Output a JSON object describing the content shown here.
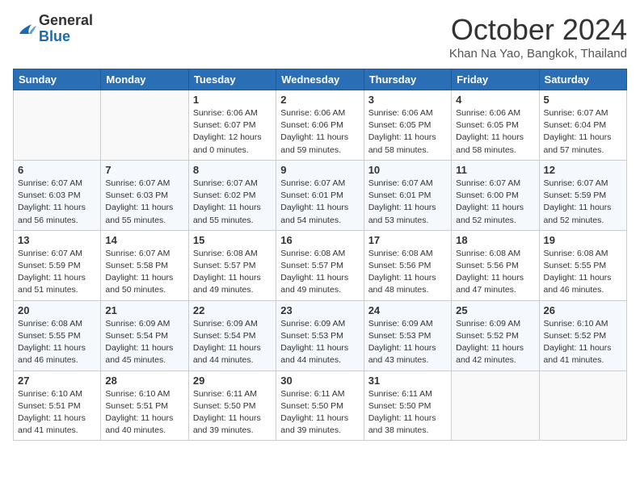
{
  "header": {
    "logo": {
      "line1": "General",
      "line2": "Blue"
    },
    "title": "October 2024",
    "location": "Khan Na Yao, Bangkok, Thailand"
  },
  "days_of_week": [
    "Sunday",
    "Monday",
    "Tuesday",
    "Wednesday",
    "Thursday",
    "Friday",
    "Saturday"
  ],
  "weeks": [
    [
      {
        "day": "",
        "info": ""
      },
      {
        "day": "",
        "info": ""
      },
      {
        "day": "1",
        "info": "Sunrise: 6:06 AM\nSunset: 6:07 PM\nDaylight: 12 hours\nand 0 minutes."
      },
      {
        "day": "2",
        "info": "Sunrise: 6:06 AM\nSunset: 6:06 PM\nDaylight: 11 hours\nand 59 minutes."
      },
      {
        "day": "3",
        "info": "Sunrise: 6:06 AM\nSunset: 6:05 PM\nDaylight: 11 hours\nand 58 minutes."
      },
      {
        "day": "4",
        "info": "Sunrise: 6:06 AM\nSunset: 6:05 PM\nDaylight: 11 hours\nand 58 minutes."
      },
      {
        "day": "5",
        "info": "Sunrise: 6:07 AM\nSunset: 6:04 PM\nDaylight: 11 hours\nand 57 minutes."
      }
    ],
    [
      {
        "day": "6",
        "info": "Sunrise: 6:07 AM\nSunset: 6:03 PM\nDaylight: 11 hours\nand 56 minutes."
      },
      {
        "day": "7",
        "info": "Sunrise: 6:07 AM\nSunset: 6:03 PM\nDaylight: 11 hours\nand 55 minutes."
      },
      {
        "day": "8",
        "info": "Sunrise: 6:07 AM\nSunset: 6:02 PM\nDaylight: 11 hours\nand 55 minutes."
      },
      {
        "day": "9",
        "info": "Sunrise: 6:07 AM\nSunset: 6:01 PM\nDaylight: 11 hours\nand 54 minutes."
      },
      {
        "day": "10",
        "info": "Sunrise: 6:07 AM\nSunset: 6:01 PM\nDaylight: 11 hours\nand 53 minutes."
      },
      {
        "day": "11",
        "info": "Sunrise: 6:07 AM\nSunset: 6:00 PM\nDaylight: 11 hours\nand 52 minutes."
      },
      {
        "day": "12",
        "info": "Sunrise: 6:07 AM\nSunset: 5:59 PM\nDaylight: 11 hours\nand 52 minutes."
      }
    ],
    [
      {
        "day": "13",
        "info": "Sunrise: 6:07 AM\nSunset: 5:59 PM\nDaylight: 11 hours\nand 51 minutes."
      },
      {
        "day": "14",
        "info": "Sunrise: 6:07 AM\nSunset: 5:58 PM\nDaylight: 11 hours\nand 50 minutes."
      },
      {
        "day": "15",
        "info": "Sunrise: 6:08 AM\nSunset: 5:57 PM\nDaylight: 11 hours\nand 49 minutes."
      },
      {
        "day": "16",
        "info": "Sunrise: 6:08 AM\nSunset: 5:57 PM\nDaylight: 11 hours\nand 49 minutes."
      },
      {
        "day": "17",
        "info": "Sunrise: 6:08 AM\nSunset: 5:56 PM\nDaylight: 11 hours\nand 48 minutes."
      },
      {
        "day": "18",
        "info": "Sunrise: 6:08 AM\nSunset: 5:56 PM\nDaylight: 11 hours\nand 47 minutes."
      },
      {
        "day": "19",
        "info": "Sunrise: 6:08 AM\nSunset: 5:55 PM\nDaylight: 11 hours\nand 46 minutes."
      }
    ],
    [
      {
        "day": "20",
        "info": "Sunrise: 6:08 AM\nSunset: 5:55 PM\nDaylight: 11 hours\nand 46 minutes."
      },
      {
        "day": "21",
        "info": "Sunrise: 6:09 AM\nSunset: 5:54 PM\nDaylight: 11 hours\nand 45 minutes."
      },
      {
        "day": "22",
        "info": "Sunrise: 6:09 AM\nSunset: 5:54 PM\nDaylight: 11 hours\nand 44 minutes."
      },
      {
        "day": "23",
        "info": "Sunrise: 6:09 AM\nSunset: 5:53 PM\nDaylight: 11 hours\nand 44 minutes."
      },
      {
        "day": "24",
        "info": "Sunrise: 6:09 AM\nSunset: 5:53 PM\nDaylight: 11 hours\nand 43 minutes."
      },
      {
        "day": "25",
        "info": "Sunrise: 6:09 AM\nSunset: 5:52 PM\nDaylight: 11 hours\nand 42 minutes."
      },
      {
        "day": "26",
        "info": "Sunrise: 6:10 AM\nSunset: 5:52 PM\nDaylight: 11 hours\nand 41 minutes."
      }
    ],
    [
      {
        "day": "27",
        "info": "Sunrise: 6:10 AM\nSunset: 5:51 PM\nDaylight: 11 hours\nand 41 minutes."
      },
      {
        "day": "28",
        "info": "Sunrise: 6:10 AM\nSunset: 5:51 PM\nDaylight: 11 hours\nand 40 minutes."
      },
      {
        "day": "29",
        "info": "Sunrise: 6:11 AM\nSunset: 5:50 PM\nDaylight: 11 hours\nand 39 minutes."
      },
      {
        "day": "30",
        "info": "Sunrise: 6:11 AM\nSunset: 5:50 PM\nDaylight: 11 hours\nand 39 minutes."
      },
      {
        "day": "31",
        "info": "Sunrise: 6:11 AM\nSunset: 5:50 PM\nDaylight: 11 hours\nand 38 minutes."
      },
      {
        "day": "",
        "info": ""
      },
      {
        "day": "",
        "info": ""
      }
    ]
  ]
}
